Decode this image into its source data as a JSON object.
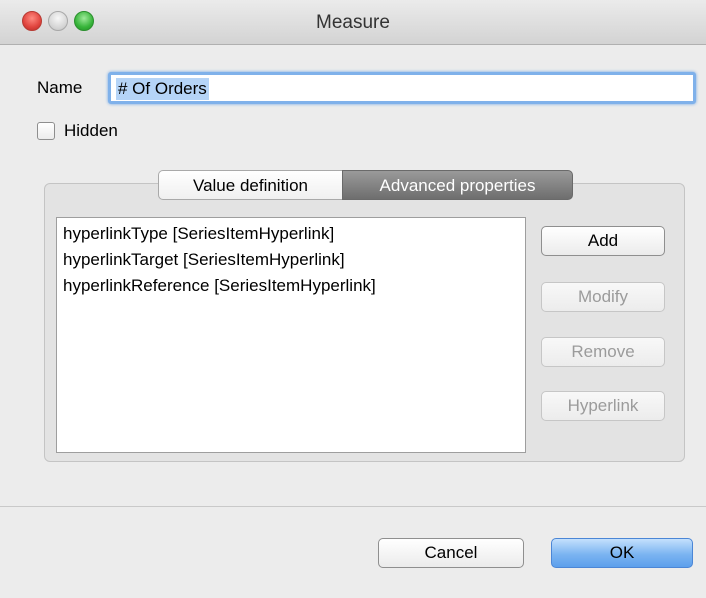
{
  "window": {
    "title": "Measure"
  },
  "form": {
    "name_label": "Name",
    "name_value": "# Of Orders",
    "hidden_label": "Hidden",
    "hidden_checked": false
  },
  "tabs": {
    "items": [
      {
        "label": "Value definition",
        "active": false
      },
      {
        "label": "Advanced properties",
        "active": true
      }
    ]
  },
  "properties": {
    "items": [
      "hyperlinkType [SeriesItemHyperlink]",
      "hyperlinkTarget [SeriesItemHyperlink]",
      "hyperlinkReference [SeriesItemHyperlink]"
    ]
  },
  "actions": {
    "add": "Add",
    "modify": "Modify",
    "remove": "Remove",
    "hyperlink": "Hyperlink"
  },
  "footer": {
    "cancel": "Cancel",
    "ok": "OK"
  },
  "colors": {
    "focus_ring": "#7fb1ea",
    "selection": "#b5d4f7",
    "active_tab": "#7d7d7d",
    "default_button": "#7bb4f1"
  }
}
